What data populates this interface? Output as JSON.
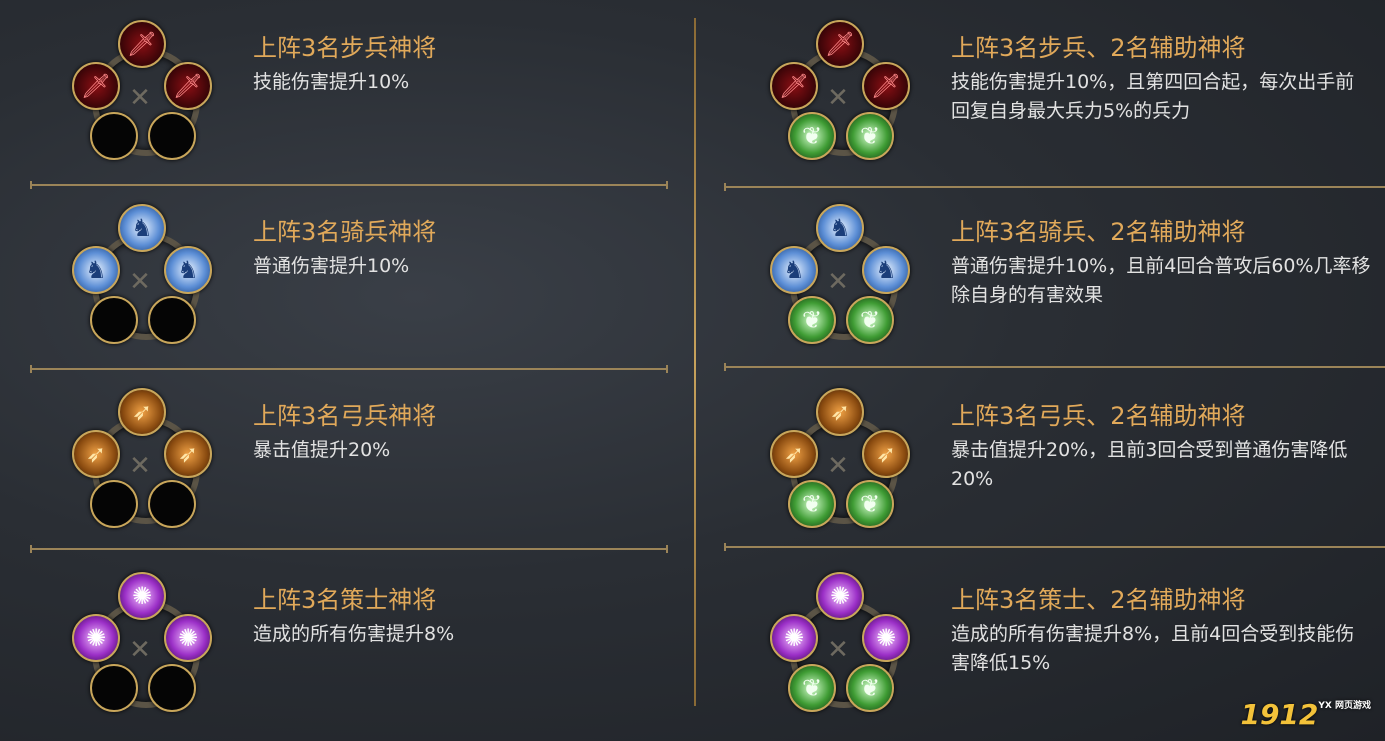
{
  "bonuses": [
    {
      "icon": "sword-icon",
      "title": "上阵3名步兵神将",
      "desc": "技能伤害提升10%"
    },
    {
      "icon": "horse-icon",
      "title": "上阵3名骑兵神将",
      "desc": "普通伤害提升10%"
    },
    {
      "icon": "bow-icon",
      "title": "上阵3名弓兵神将",
      "desc": "暴击值提升20%"
    },
    {
      "icon": "spell-icon",
      "title": "上阵3名策士神将",
      "desc": "造成的所有伤害提升8%"
    },
    {
      "icon": "sword-icon",
      "title": "上阵3名步兵、2名辅助神将",
      "desc": "技能伤害提升10%，且第四回合起，每次出手前回复自身最大兵力5%的兵力"
    },
    {
      "icon": "horse-icon",
      "title": "上阵3名骑兵、2名辅助神将",
      "desc": "普通伤害提升10%，且前4回合普攻后60%几率移除自身的有害效果"
    },
    {
      "icon": "bow-icon",
      "title": "上阵3名弓兵、2名辅助神将",
      "desc": "暴击值提升20%，且前3回合受到普通伤害降低20%"
    },
    {
      "icon": "spell-icon",
      "title": "上阵3名策士、2名辅助神将",
      "desc": "造成的所有伤害提升8%，且前4回合受到技能伤害降低15%"
    }
  ],
  "glyphs": {
    "sword": "🗡",
    "horse": "♞",
    "bow": "➶",
    "spell": "✺",
    "gourd": "❦"
  },
  "watermark": {
    "main": "1912",
    "sub": "YX 网页游戏"
  },
  "colors": {
    "title": "#e1a95a",
    "desc": "#e2e2e2",
    "divider": "#c7a25c"
  }
}
